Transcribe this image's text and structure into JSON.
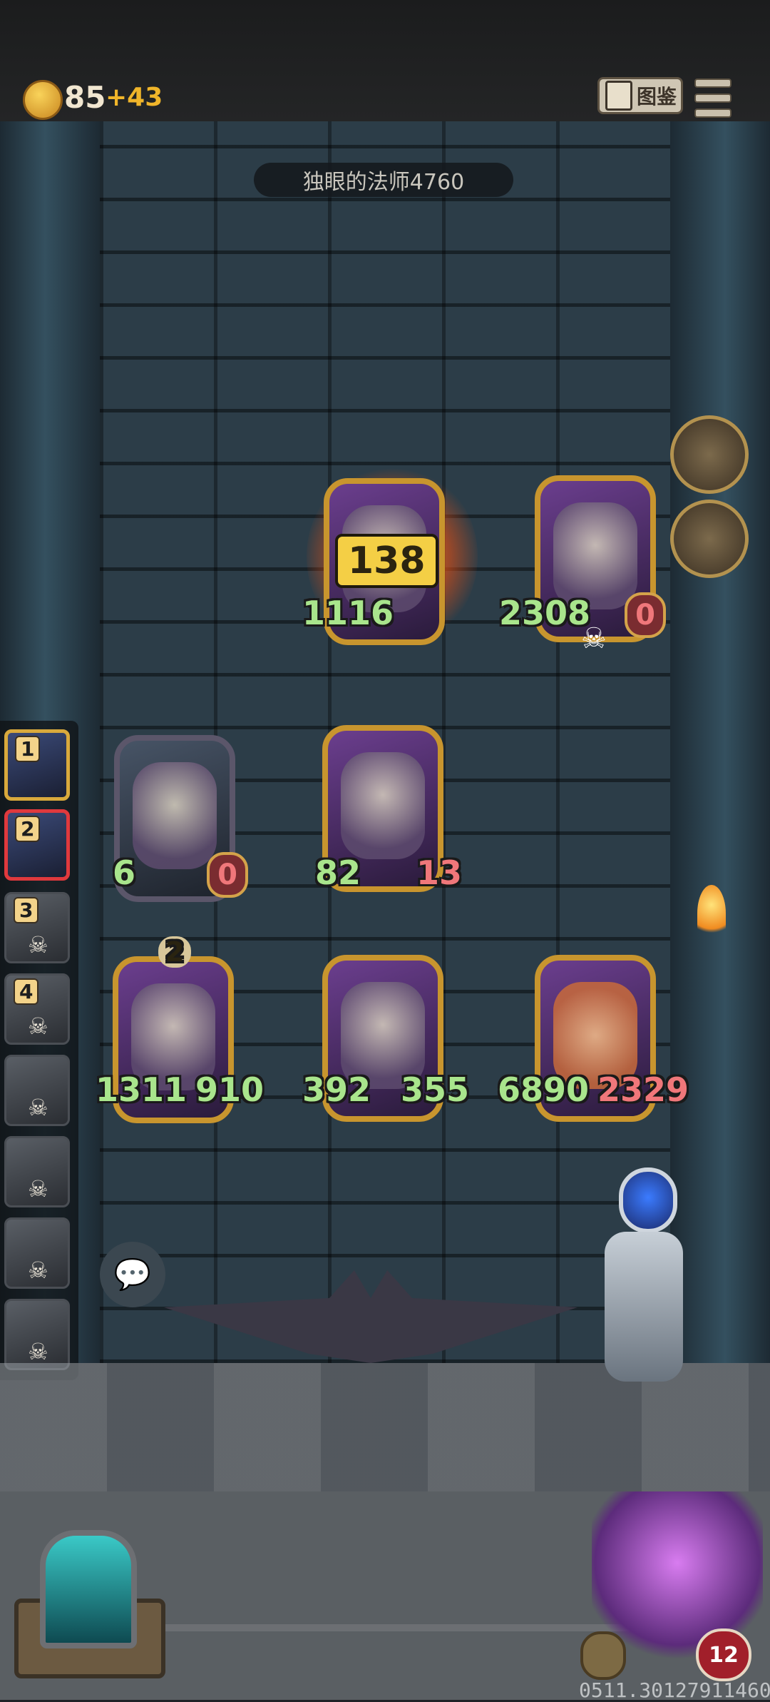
{
  "hud": {
    "coins": "85",
    "coins_income": "+43",
    "codex_label": "图鉴"
  },
  "enemy": {
    "name": "独眼的法师4760"
  },
  "board": {
    "damage_popup": "138",
    "enemy_cards": [
      {
        "attack": "1116",
        "hp": "",
        "on_fire": true
      },
      {
        "attack": "2308",
        "hp": "0"
      }
    ],
    "player_cards_row1": [
      {
        "attack": "6",
        "hp": "0",
        "frame": "stone"
      },
      {
        "attack": "82",
        "hp": "13",
        "frame": "gold"
      }
    ],
    "player_cards_row2": [
      {
        "attack": "1311",
        "hp": "910",
        "level": "2"
      },
      {
        "attack": "392",
        "hp": "355"
      },
      {
        "attack": "6890",
        "hp": "2329"
      }
    ]
  },
  "round_tokens": [
    {
      "icon": "rat-icon"
    },
    {
      "icon": "rat-icon"
    }
  ],
  "sidebar": {
    "slots": [
      {
        "num": "1",
        "state": "active"
      },
      {
        "num": "2",
        "state": "selected"
      },
      {
        "num": "3",
        "state": "dead"
      },
      {
        "num": "4",
        "state": "dead"
      },
      {
        "num": "",
        "state": "dead"
      },
      {
        "num": "",
        "state": "dead"
      },
      {
        "num": "",
        "state": "dead"
      },
      {
        "num": "",
        "state": "dead"
      }
    ]
  },
  "player": {
    "lives": "12"
  },
  "footer": {
    "seed": "0511.30127911460"
  },
  "colors": {
    "attack": "#a9e58c",
    "hp": "#f0777a",
    "gold": "#c8952e"
  }
}
